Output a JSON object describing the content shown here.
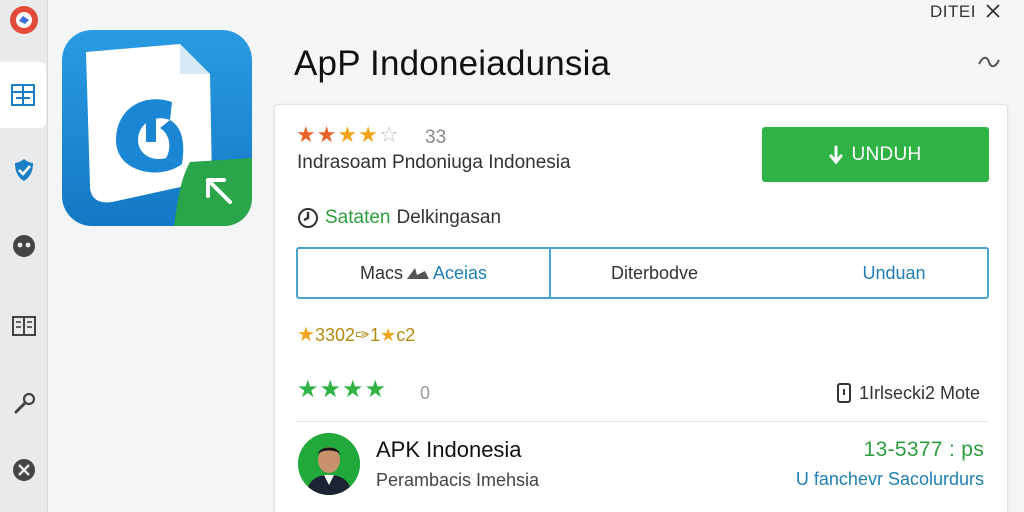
{
  "window": {
    "label": "DITEI"
  },
  "app": {
    "title": "ApP Indoneiadunsia",
    "rating_value": "33",
    "developer_line": "Indrasoam Pndoniuga Indonesia"
  },
  "actions": {
    "download_label": "UNDUH"
  },
  "safety": {
    "label_green": "Sataten",
    "label_rest": "Delkingasan"
  },
  "tabs": [
    {
      "label_a": "Macs",
      "label_b": "Aceias"
    },
    {
      "label": "Diterbodve"
    },
    {
      "label": "Unduan"
    }
  ],
  "scores": {
    "text": "3302✑1",
    "text_b": "c2"
  },
  "reviews": {
    "count": "0",
    "report_label": "1Irlsecki2 Mote"
  },
  "publisher": {
    "name": "APK Indonesia",
    "subtitle": "Perambacis Imehsia",
    "size": "13-5377 : ps",
    "status": "U fanchevr Sacolurdurs"
  },
  "colors": {
    "accent_green": "#2fb344",
    "accent_blue": "#1f7fb3",
    "star_gold": "#f0a51c",
    "star_orange": "#e8622a"
  }
}
